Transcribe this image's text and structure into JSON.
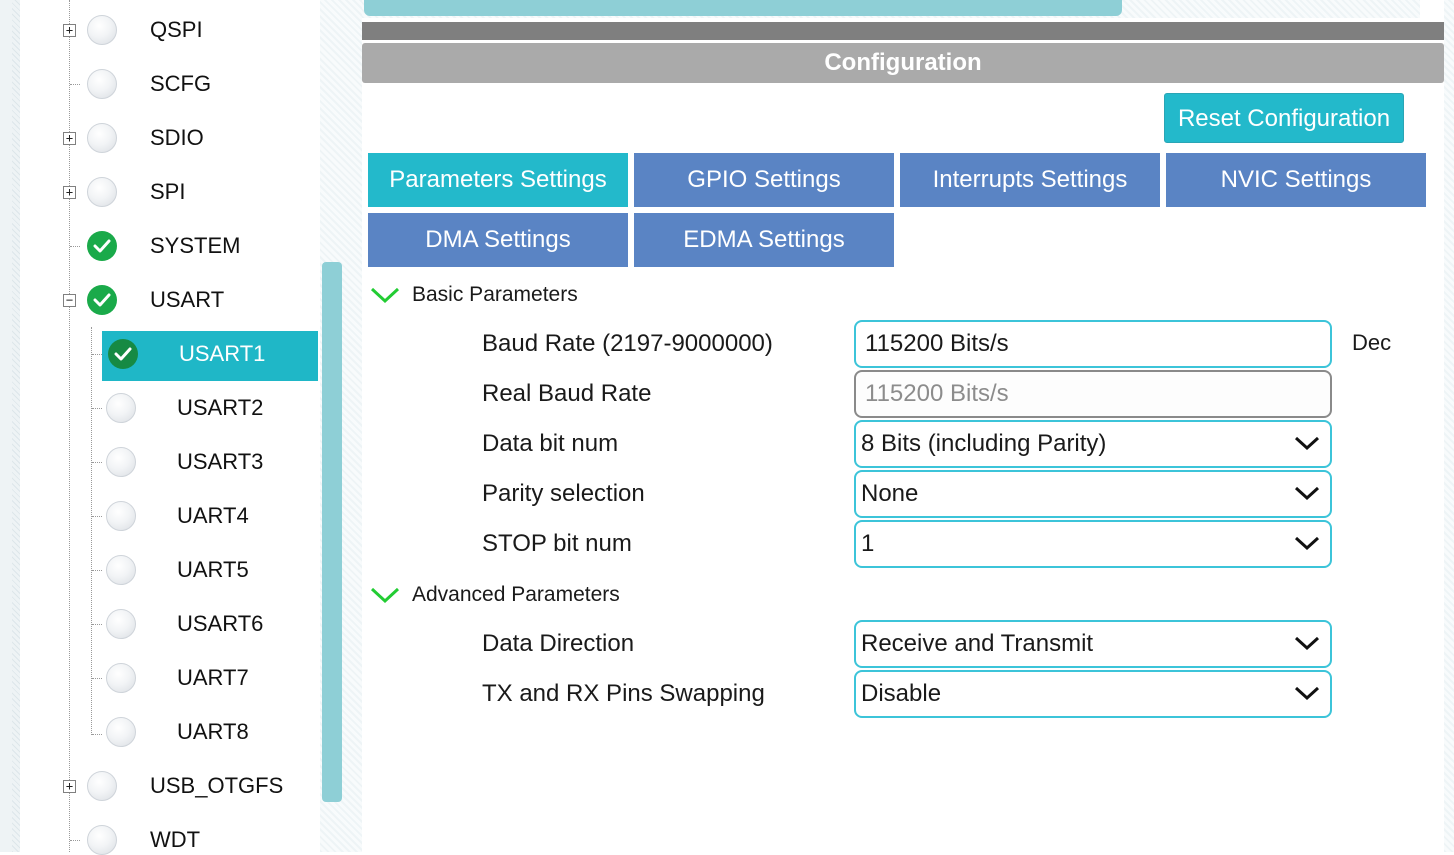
{
  "tree": {
    "items": [
      {
        "label": "QSPI",
        "status": "empty",
        "expander": "+"
      },
      {
        "label": "SCFG",
        "status": "empty",
        "expander": ""
      },
      {
        "label": "SDIO",
        "status": "empty",
        "expander": "+"
      },
      {
        "label": "SPI",
        "status": "empty",
        "expander": "+"
      },
      {
        "label": "SYSTEM",
        "status": "ok",
        "expander": ""
      },
      {
        "label": "USART",
        "status": "ok",
        "expander": "−"
      },
      {
        "label": "USART1",
        "status": "ok",
        "expander": "",
        "selected": true
      },
      {
        "label": "USART2",
        "status": "empty",
        "expander": ""
      },
      {
        "label": "USART3",
        "status": "empty",
        "expander": ""
      },
      {
        "label": "UART4",
        "status": "empty",
        "expander": ""
      },
      {
        "label": "UART5",
        "status": "empty",
        "expander": ""
      },
      {
        "label": "USART6",
        "status": "empty",
        "expander": ""
      },
      {
        "label": "UART7",
        "status": "empty",
        "expander": ""
      },
      {
        "label": "UART8",
        "status": "empty",
        "expander": ""
      },
      {
        "label": "USB_OTGFS",
        "status": "empty",
        "expander": "+"
      },
      {
        "label": "WDT",
        "status": "empty",
        "expander": ""
      }
    ]
  },
  "config": {
    "title": "Configuration",
    "reset_label": "Reset Configuration",
    "tabs": [
      {
        "label": "Parameters Settings",
        "active": true
      },
      {
        "label": "GPIO Settings"
      },
      {
        "label": "Interrupts Settings"
      },
      {
        "label": "NVIC Settings"
      },
      {
        "label": "DMA Settings"
      },
      {
        "label": "EDMA Settings"
      }
    ],
    "basic": {
      "header": "Basic Parameters",
      "baud_rate": {
        "label": "Baud Rate (2197-9000000)",
        "value": "115200 Bits/s",
        "unit": "Dec"
      },
      "real_baud_rate": {
        "label": "Real Baud Rate",
        "value": "115200 Bits/s"
      },
      "data_bit_num": {
        "label": "Data bit num",
        "value": "8 Bits (including Parity)"
      },
      "parity": {
        "label": "Parity selection",
        "value": "None"
      },
      "stop_bit": {
        "label": "STOP bit num",
        "value": "1"
      }
    },
    "advanced": {
      "header": "Advanced Parameters",
      "data_direction": {
        "label": "Data Direction",
        "value": "Receive and Transmit"
      },
      "pin_swap": {
        "label": "TX and RX Pins Swapping",
        "value": "Disable"
      }
    }
  },
  "colors": {
    "accent": "#23b9cb",
    "tab_inactive": "#5a84c4",
    "header_gray": "#aaaaaa",
    "ok_green": "#1aaa4a",
    "chevron_green": "#22cc33"
  }
}
